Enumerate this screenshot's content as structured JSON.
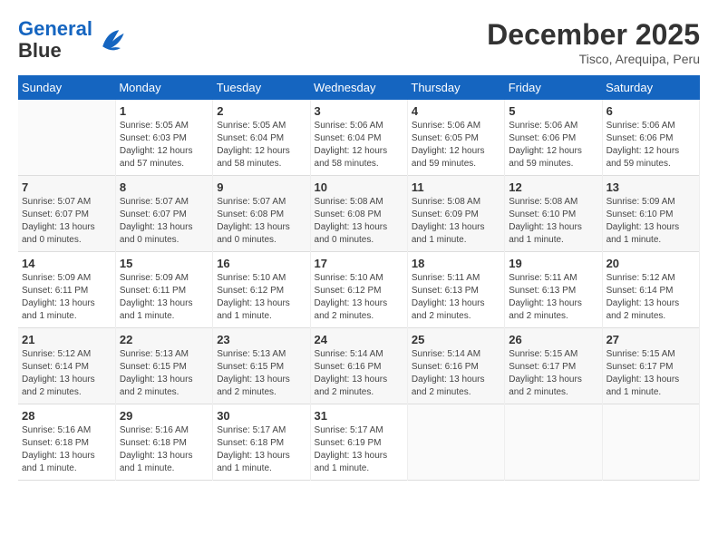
{
  "header": {
    "logo_line1": "General",
    "logo_line2": "Blue",
    "month_title": "December 2025",
    "location": "Tisco, Arequipa, Peru"
  },
  "weekdays": [
    "Sunday",
    "Monday",
    "Tuesday",
    "Wednesday",
    "Thursday",
    "Friday",
    "Saturday"
  ],
  "weeks": [
    [
      {
        "day": "",
        "empty": true
      },
      {
        "day": "1",
        "sunrise": "5:05 AM",
        "sunset": "6:03 PM",
        "daylight": "12 hours and 57 minutes."
      },
      {
        "day": "2",
        "sunrise": "5:05 AM",
        "sunset": "6:04 PM",
        "daylight": "12 hours and 58 minutes."
      },
      {
        "day": "3",
        "sunrise": "5:06 AM",
        "sunset": "6:04 PM",
        "daylight": "12 hours and 58 minutes."
      },
      {
        "day": "4",
        "sunrise": "5:06 AM",
        "sunset": "6:05 PM",
        "daylight": "12 hours and 59 minutes."
      },
      {
        "day": "5",
        "sunrise": "5:06 AM",
        "sunset": "6:06 PM",
        "daylight": "12 hours and 59 minutes."
      },
      {
        "day": "6",
        "sunrise": "5:06 AM",
        "sunset": "6:06 PM",
        "daylight": "12 hours and 59 minutes."
      }
    ],
    [
      {
        "day": "7",
        "sunrise": "5:07 AM",
        "sunset": "6:07 PM",
        "daylight": "13 hours and 0 minutes."
      },
      {
        "day": "8",
        "sunrise": "5:07 AM",
        "sunset": "6:07 PM",
        "daylight": "13 hours and 0 minutes."
      },
      {
        "day": "9",
        "sunrise": "5:07 AM",
        "sunset": "6:08 PM",
        "daylight": "13 hours and 0 minutes."
      },
      {
        "day": "10",
        "sunrise": "5:08 AM",
        "sunset": "6:08 PM",
        "daylight": "13 hours and 0 minutes."
      },
      {
        "day": "11",
        "sunrise": "5:08 AM",
        "sunset": "6:09 PM",
        "daylight": "13 hours and 1 minute."
      },
      {
        "day": "12",
        "sunrise": "5:08 AM",
        "sunset": "6:10 PM",
        "daylight": "13 hours and 1 minute."
      },
      {
        "day": "13",
        "sunrise": "5:09 AM",
        "sunset": "6:10 PM",
        "daylight": "13 hours and 1 minute."
      }
    ],
    [
      {
        "day": "14",
        "sunrise": "5:09 AM",
        "sunset": "6:11 PM",
        "daylight": "13 hours and 1 minute."
      },
      {
        "day": "15",
        "sunrise": "5:09 AM",
        "sunset": "6:11 PM",
        "daylight": "13 hours and 1 minute."
      },
      {
        "day": "16",
        "sunrise": "5:10 AM",
        "sunset": "6:12 PM",
        "daylight": "13 hours and 1 minute."
      },
      {
        "day": "17",
        "sunrise": "5:10 AM",
        "sunset": "6:12 PM",
        "daylight": "13 hours and 2 minutes."
      },
      {
        "day": "18",
        "sunrise": "5:11 AM",
        "sunset": "6:13 PM",
        "daylight": "13 hours and 2 minutes."
      },
      {
        "day": "19",
        "sunrise": "5:11 AM",
        "sunset": "6:13 PM",
        "daylight": "13 hours and 2 minutes."
      },
      {
        "day": "20",
        "sunrise": "5:12 AM",
        "sunset": "6:14 PM",
        "daylight": "13 hours and 2 minutes."
      }
    ],
    [
      {
        "day": "21",
        "sunrise": "5:12 AM",
        "sunset": "6:14 PM",
        "daylight": "13 hours and 2 minutes."
      },
      {
        "day": "22",
        "sunrise": "5:13 AM",
        "sunset": "6:15 PM",
        "daylight": "13 hours and 2 minutes."
      },
      {
        "day": "23",
        "sunrise": "5:13 AM",
        "sunset": "6:15 PM",
        "daylight": "13 hours and 2 minutes."
      },
      {
        "day": "24",
        "sunrise": "5:14 AM",
        "sunset": "6:16 PM",
        "daylight": "13 hours and 2 minutes."
      },
      {
        "day": "25",
        "sunrise": "5:14 AM",
        "sunset": "6:16 PM",
        "daylight": "13 hours and 2 minutes."
      },
      {
        "day": "26",
        "sunrise": "5:15 AM",
        "sunset": "6:17 PM",
        "daylight": "13 hours and 2 minutes."
      },
      {
        "day": "27",
        "sunrise": "5:15 AM",
        "sunset": "6:17 PM",
        "daylight": "13 hours and 1 minute."
      }
    ],
    [
      {
        "day": "28",
        "sunrise": "5:16 AM",
        "sunset": "6:18 PM",
        "daylight": "13 hours and 1 minute."
      },
      {
        "day": "29",
        "sunrise": "5:16 AM",
        "sunset": "6:18 PM",
        "daylight": "13 hours and 1 minute."
      },
      {
        "day": "30",
        "sunrise": "5:17 AM",
        "sunset": "6:18 PM",
        "daylight": "13 hours and 1 minute."
      },
      {
        "day": "31",
        "sunrise": "5:17 AM",
        "sunset": "6:19 PM",
        "daylight": "13 hours and 1 minute."
      },
      {
        "day": "",
        "empty": true
      },
      {
        "day": "",
        "empty": true
      },
      {
        "day": "",
        "empty": true
      }
    ]
  ]
}
